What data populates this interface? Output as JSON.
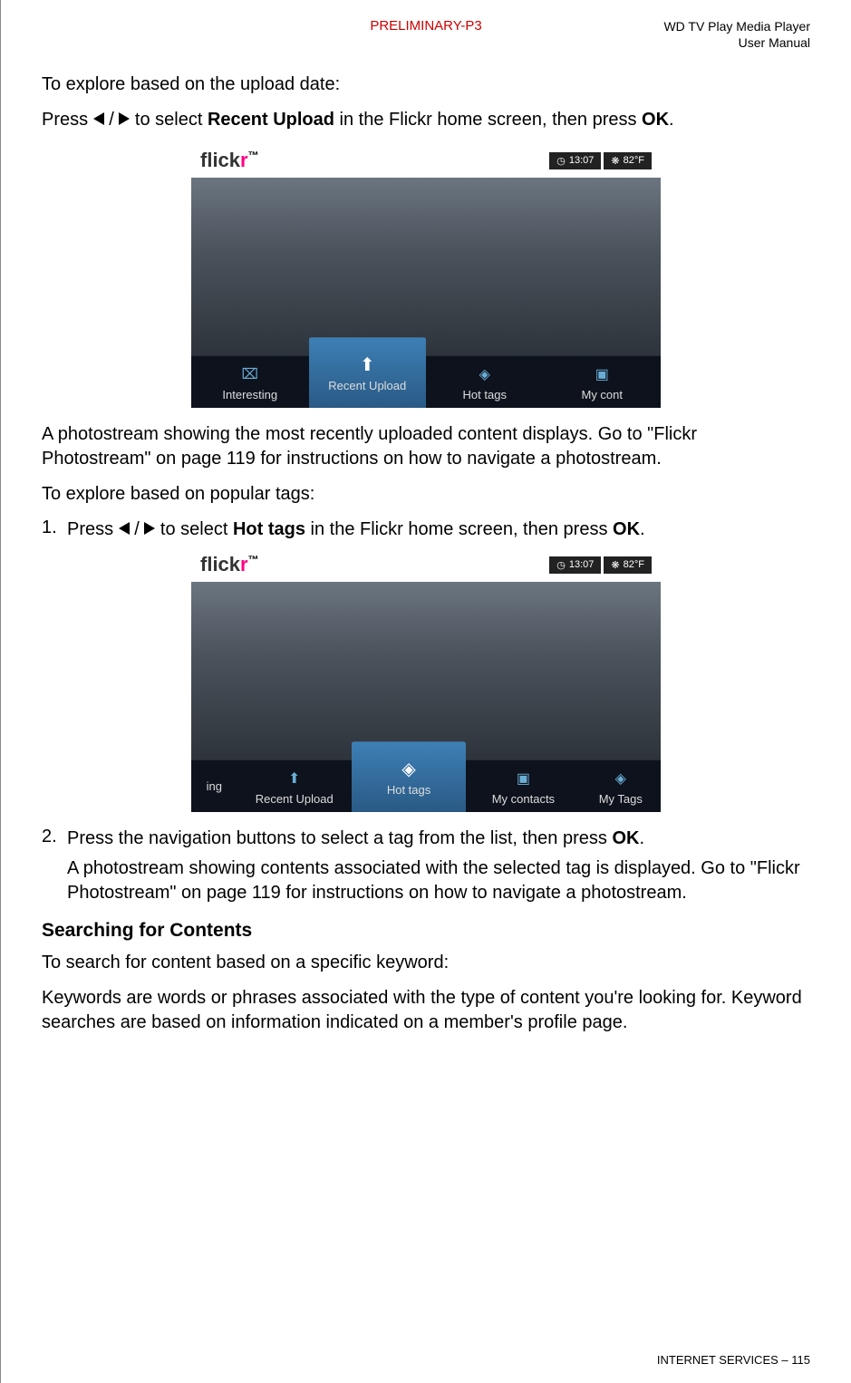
{
  "header": {
    "center": "PRELIMINARY-P3",
    "right_line1": "WD TV Play Media Player",
    "right_line2": "User Manual"
  },
  "para1": "To explore based on the upload date:",
  "para2_pre": "Press ",
  "para2_mid": " to select ",
  "para2_bold1": "Recent Upload",
  "para2_post": " in the Flickr home screen, then press ",
  "para2_bold2": "OK",
  "para2_end": ".",
  "screenshot1": {
    "logo1": "flick",
    "logo2": "r",
    "time": "13:07",
    "temp": "82°F",
    "nav": [
      {
        "label": "Interesting",
        "icon": "⌧"
      },
      {
        "label": "Recent Upload",
        "icon": "⬆"
      },
      {
        "label": "Hot tags",
        "icon": "◈"
      },
      {
        "label": "My cont",
        "icon": "▣"
      }
    ],
    "selected_index": 1
  },
  "para3": "A photostream showing the most recently uploaded content displays. Go to \"Flickr Photostream\" on page 119 for instructions on how to navigate a photostream.",
  "para4": "To explore based on popular tags:",
  "step1_num": "1.",
  "step1_pre": "Press ",
  "step1_mid": " to select ",
  "step1_bold1": "Hot tags",
  "step1_post": " in the Flickr home screen, then press ",
  "step1_bold2": "OK",
  "step1_end": ".",
  "screenshot2": {
    "logo1": "flick",
    "logo2": "r",
    "time": "13:07",
    "temp": "82°F",
    "nav": [
      {
        "label": "ing",
        "icon": ""
      },
      {
        "label": "Recent Upload",
        "icon": "⬆"
      },
      {
        "label": "Hot tags",
        "icon": "◈"
      },
      {
        "label": "My contacts",
        "icon": "▣"
      },
      {
        "label": "My Tags",
        "icon": "◈"
      }
    ],
    "selected_index": 2
  },
  "step2_num": "2.",
  "step2_line1_pre": "Press the navigation buttons to select a tag from the list, then press ",
  "step2_line1_bold": "OK",
  "step2_line1_end": ".",
  "step2_line2": "A photostream showing contents associated with the selected tag is displayed. Go to \"Flickr Photostream\" on page 119 for instructions on how to navigate a photostream.",
  "heading": "Searching for Contents",
  "para5": "To search for content based on a specific keyword:",
  "para6": "Keywords are words or phrases associated with the type of content you're looking for. Keyword searches are based on information indicated on a member's profile page.",
  "footer_section": "INTERNET SERVICES",
  "footer_page": "– 115"
}
